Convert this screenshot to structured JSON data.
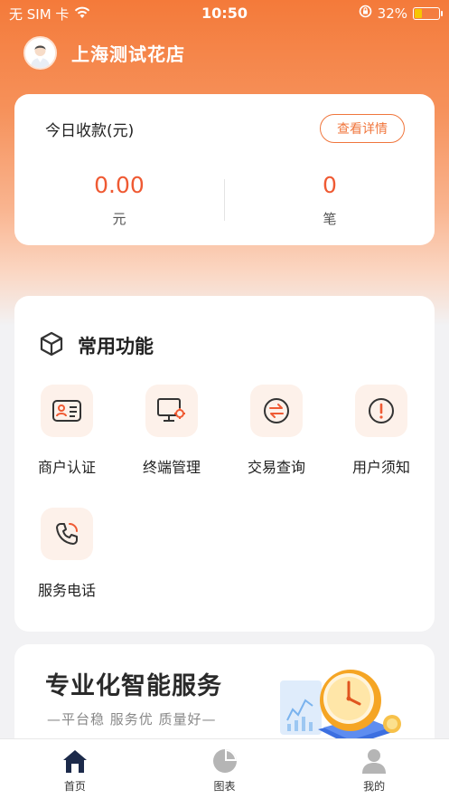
{
  "status_bar": {
    "carrier": "无 SIM 卡",
    "time": "10:50",
    "battery": "32%",
    "battery_level": 0.32
  },
  "header": {
    "shop_name": "上海测试花店"
  },
  "income": {
    "title": "今日收款(元)",
    "detail_button": "查看详情",
    "amount_value": "0.00",
    "amount_unit": "元",
    "count_value": "0",
    "count_unit": "笔"
  },
  "functions": {
    "title": "常用功能",
    "items": [
      {
        "label": "商户认证",
        "icon": "id-card-icon"
      },
      {
        "label": "终端管理",
        "icon": "terminal-settings-icon"
      },
      {
        "label": "交易查询",
        "icon": "exchange-icon"
      },
      {
        "label": "用户须知",
        "icon": "alert-icon"
      },
      {
        "label": "服务电话",
        "icon": "phone-icon"
      }
    ]
  },
  "banner": {
    "title": "专业化智能服务",
    "subtitle": "—平台稳  服务优  质量好—"
  },
  "tabbar": {
    "items": [
      {
        "label": "首页",
        "icon": "home-icon",
        "active": true
      },
      {
        "label": "图表",
        "icon": "pie-chart-icon",
        "active": false
      },
      {
        "label": "我的",
        "icon": "user-icon",
        "active": false
      }
    ]
  },
  "colors": {
    "accent": "#f0763d",
    "value_red": "#ef5a33",
    "tab_active": "#1c2a4a",
    "tab_inactive": "#b5b5b5"
  }
}
